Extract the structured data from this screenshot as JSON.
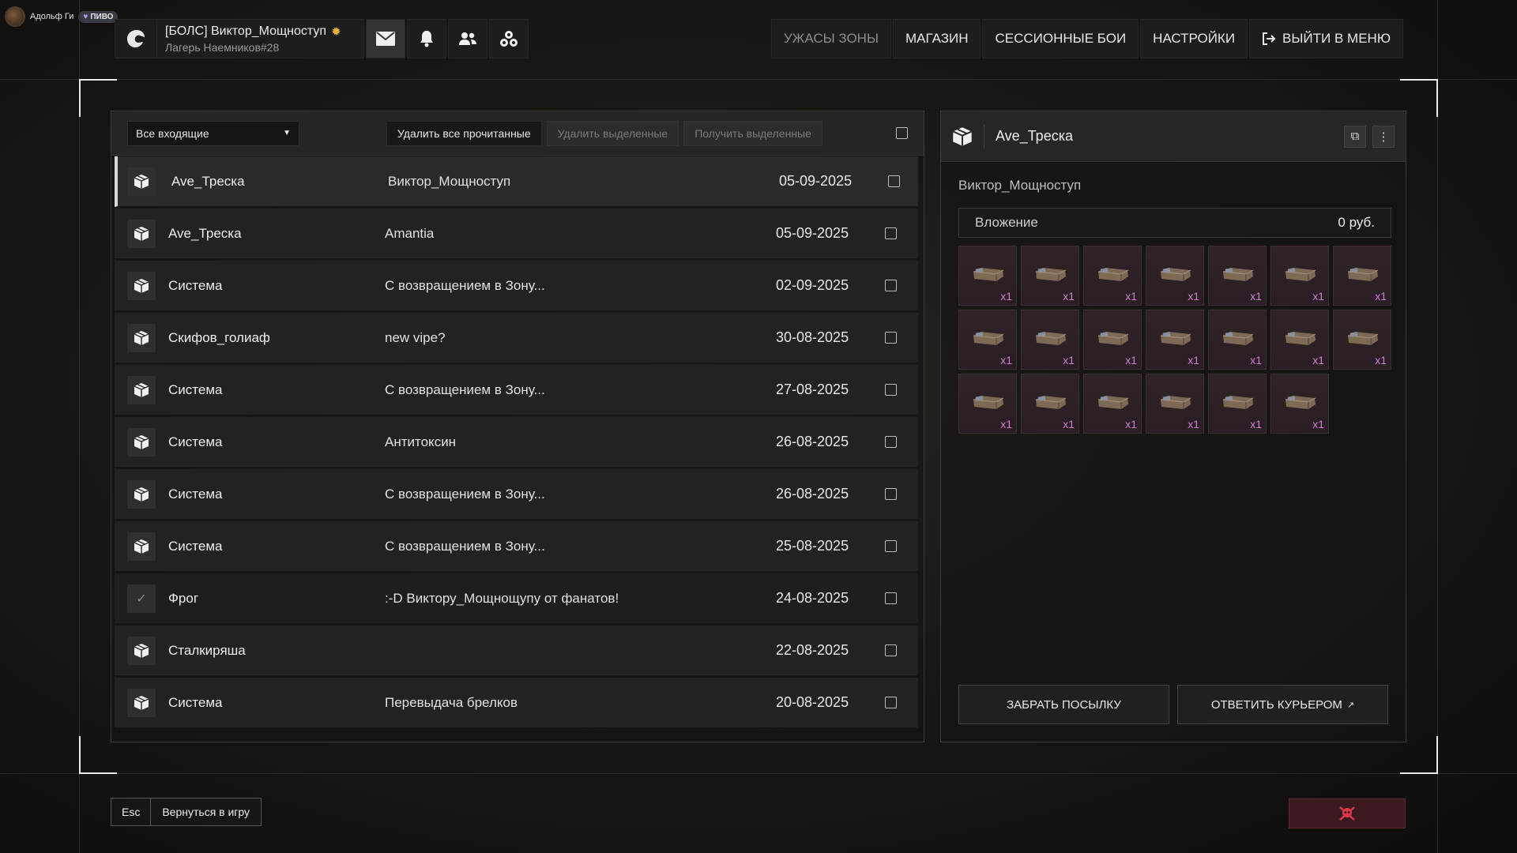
{
  "stream": {
    "name": "Адольф Ги",
    "tag": "ПИВО"
  },
  "player": {
    "name": "[БОЛС] Виктор_Мощноступ",
    "subtitle": "Лагерь Наемников#28"
  },
  "header_icons": [
    "mail-icon",
    "bell-icon",
    "friends-icon",
    "groups-icon"
  ],
  "nav": {
    "horrors": "УЖАСЫ ЗОНЫ",
    "shop": "МАГАЗИН",
    "session_battles": "СЕССИОННЫЕ БОИ",
    "settings": "НАСТРОЙКИ",
    "exit": "ВЫЙТИ В МЕНЮ"
  },
  "toolbar": {
    "filter": "Все входящие",
    "delete_read": "Удалить все прочитанные",
    "delete_selected": "Удалить выделенные",
    "receive_selected": "Получить выделенные"
  },
  "messages": [
    {
      "sender": "Ave_Треска",
      "subject": "Виктор_Мощноступ",
      "date": "05-09-2025"
    },
    {
      "sender": "Ave_Треска",
      "subject": "Amantia",
      "date": "05-09-2025"
    },
    {
      "sender": "Система",
      "subject": "С возвращением в Зону...",
      "date": "02-09-2025"
    },
    {
      "sender": "Скифов_голиаф",
      "subject": "new vipe?",
      "date": "30-08-2025"
    },
    {
      "sender": "Система",
      "subject": "С возвращением в Зону...",
      "date": "27-08-2025"
    },
    {
      "sender": "Система",
      "subject": "Антитоксин",
      "date": "26-08-2025"
    },
    {
      "sender": "Система",
      "subject": "С возвращением в Зону...",
      "date": "26-08-2025"
    },
    {
      "sender": "Система",
      "subject": "С возвращением в Зону...",
      "date": "25-08-2025"
    },
    {
      "sender": "Фрог",
      "subject": ":-D Виктору_Мощнощупу от фанатов!",
      "date": "24-08-2025"
    },
    {
      "sender": "Сталкиряша",
      "subject": "",
      "date": "22-08-2025"
    },
    {
      "sender": "Система",
      "subject": "Перевыдача брелков",
      "date": "20-08-2025"
    }
  ],
  "detail": {
    "title": "Ave_Треска",
    "recipient": "Виктор_Мощноступ",
    "attachment_label": "Вложение",
    "attachment_value": "0 руб.",
    "item_qty": "x1",
    "item_count": 20,
    "take_button": "ЗАБРАТЬ ПОСЫЛКУ",
    "reply_button": "ОТВЕТИТЬ КУРЬЕРОМ"
  },
  "footer": {
    "esc": "Esc",
    "back": "Вернуться в игру"
  }
}
